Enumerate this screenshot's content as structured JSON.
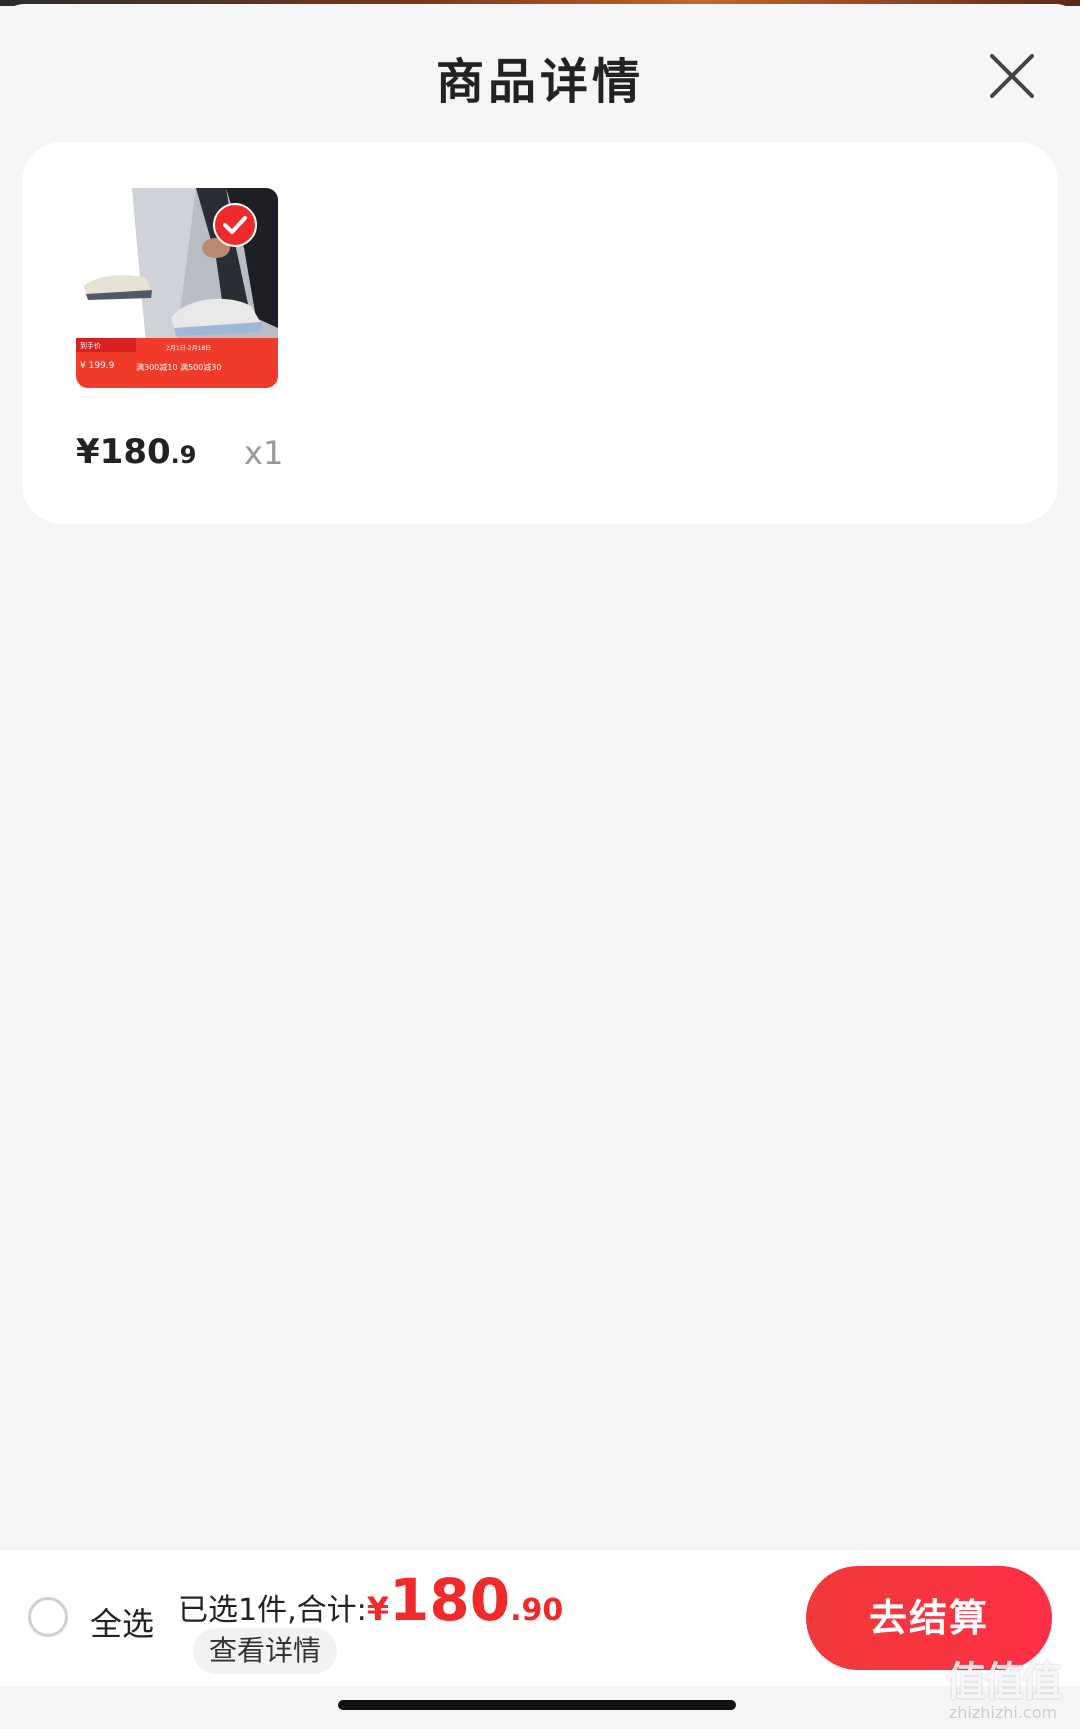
{
  "sheet": {
    "title": "商品详情",
    "close_icon": "close-icon"
  },
  "product": {
    "image_icon": "running-shoe-product-image",
    "selected_icon": "checkmark-circle-icon",
    "price_symbol": "¥",
    "price_int": "180",
    "price_dec": ".9",
    "quantity": "x1",
    "image_banner": {
      "tag": "到手价",
      "price": "¥ 199.9",
      "promo": "满300减10 满500减30",
      "dates": "2月1日-2月18日"
    }
  },
  "bottom_bar": {
    "select_all_label": "全选",
    "summary_label": "已选1件,合计:",
    "total_symbol": "¥",
    "total_int": "180",
    "total_dec": ".90",
    "detail_link": "查看详情",
    "checkout_label": "去结算"
  },
  "watermark": {
    "logo": "值值值",
    "domain": "zhizhizhi.com"
  },
  "colors": {
    "accent": "#ee2a2a",
    "background": "#f5f5f5",
    "card": "#ffffff"
  }
}
